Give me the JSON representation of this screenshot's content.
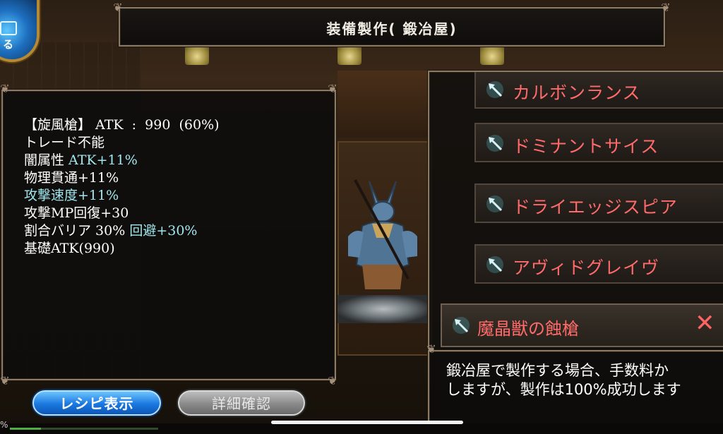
{
  "window": {
    "title": "装備製作(  鍛冶屋)"
  },
  "menu": {
    "label": "る",
    "icon": "menu-icon"
  },
  "item_stats": {
    "lines": [
      {
        "text": "【旋風槍】 ATK  :  990  (60%)"
      },
      {
        "text": "トレード不能"
      },
      {
        "prefix": "闇属性 ",
        "value": "ATK+11%"
      },
      {
        "text": "物理貫通+11%"
      },
      {
        "highlight": "攻撃速度+11%"
      },
      {
        "text": "攻撃MP回復+30"
      },
      {
        "prefix": "割合バリア 30% ",
        "value": "回避+30%"
      },
      {
        "text": "基礎ATK(990)"
      }
    ]
  },
  "recipe_list": {
    "items": [
      {
        "name": "カルボンランス",
        "icon": "spear-icon"
      },
      {
        "name": "ドミナントサイス",
        "icon": "spear-icon"
      },
      {
        "name": "ドライエッジスピア",
        "icon": "spear-icon"
      },
      {
        "name": "アヴィドグレイヴ",
        "icon": "spear-icon"
      }
    ],
    "selected": {
      "name": "魔晶獣の蝕槍",
      "icon": "spear-icon",
      "close": "✕"
    }
  },
  "description": {
    "line1": "鍛冶屋で製作する場合、手数料か",
    "line2": "しますが、製作は100%成功します"
  },
  "buttons": {
    "recipe": "レシピ表示",
    "detail": "詳細確認"
  },
  "status": {
    "percent_label": "%",
    "progress": 0.21
  },
  "colors": {
    "recipe_name": "#ff6a6a",
    "stat_highlight": "#9fe7ee",
    "primary_button": "#1a78e0"
  }
}
